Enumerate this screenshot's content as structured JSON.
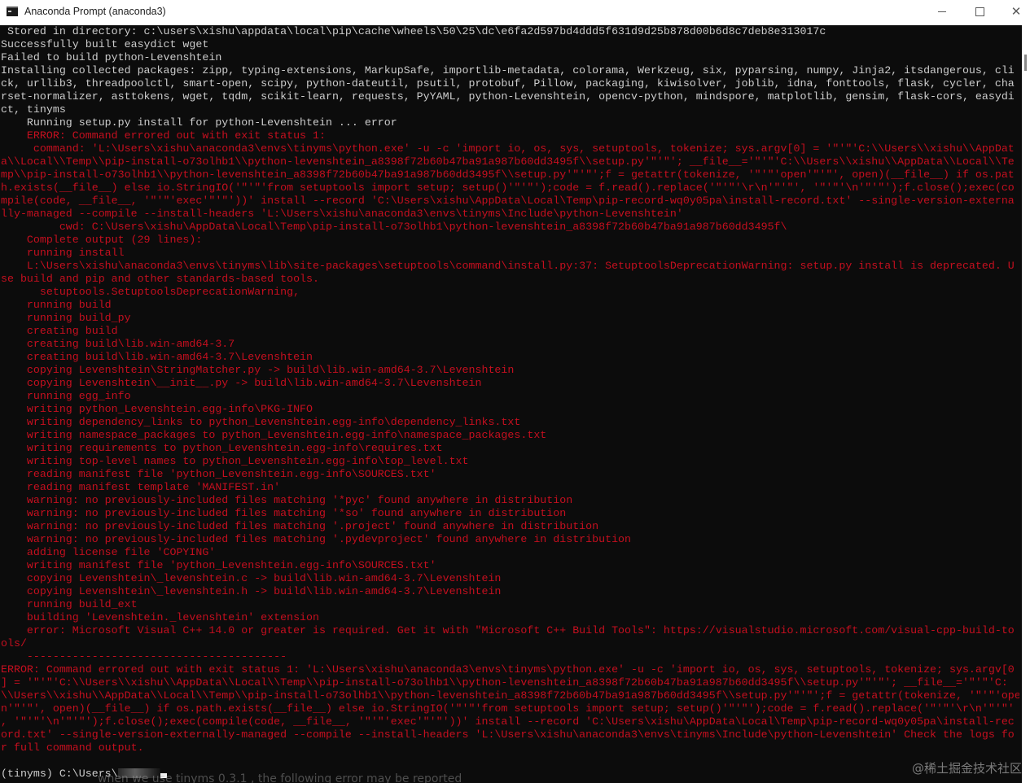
{
  "window": {
    "title": "Anaconda Prompt (anaconda3)"
  },
  "console": {
    "lines": [
      {
        "text": " Stored in directory: c:\\users\\xishu\\appdata\\local\\pip\\cache\\wheels\\50\\25\\dc\\e6fa2d597bd4ddd5f631d9d25b878d00b6d8c7deb8e313017c",
        "kind": "out"
      },
      {
        "text": "Successfully built easydict wget",
        "kind": "out"
      },
      {
        "text": "Failed to build python-Levenshtein",
        "kind": "out"
      },
      {
        "text": "Installing collected packages: zipp, typing-extensions, MarkupSafe, importlib-metadata, colorama, Werkzeug, six, pyparsing, numpy, Jinja2, itsdangerous, cli",
        "kind": "out"
      },
      {
        "text": "ck, urllib3, threadpoolctl, smart-open, scipy, python-dateutil, psutil, protobuf, Pillow, packaging, kiwisolver, joblib, idna, fonttools, flask, cycler, cha",
        "kind": "out"
      },
      {
        "text": "rset-normalizer, asttokens, wget, tqdm, scikit-learn, requests, PyYAML, python-Levenshtein, opencv-python, mindspore, matplotlib, gensim, flask-cors, easydi",
        "kind": "out"
      },
      {
        "text": "ct, tinyms",
        "kind": "out"
      },
      {
        "text": "    Running setup.py install for python-Levenshtein ... error",
        "kind": "out"
      },
      {
        "text": "    ERROR: Command errored out with exit status 1:",
        "kind": "err"
      },
      {
        "text": "     command: 'L:\\Users\\xishu\\anaconda3\\envs\\tinyms\\python.exe' -u -c 'import io, os, sys, setuptools, tokenize; sys.argv[0] = '\"'\"'C:\\\\Users\\\\xishu\\\\AppDat",
        "kind": "err"
      },
      {
        "text": "a\\\\Local\\\\Temp\\\\pip-install-o73olhb1\\\\python-levenshtein_a8398f72b60b47ba91a987b60dd3495f\\\\setup.py'\"'\"'; __file__='\"'\"'C:\\\\Users\\\\xishu\\\\AppData\\\\Local\\\\Te",
        "kind": "err"
      },
      {
        "text": "mp\\\\pip-install-o73olhb1\\\\python-levenshtein_a8398f72b60b47ba91a987b60dd3495f\\\\setup.py'\"'\"';f = getattr(tokenize, '\"'\"'open'\"'\"', open)(__file__) if os.pat",
        "kind": "err"
      },
      {
        "text": "h.exists(__file__) else io.StringIO('\"'\"'from setuptools import setup; setup()'\"'\"');code = f.read().replace('\"'\"'\\r\\n'\"'\"', '\"'\"'\\n'\"'\"');f.close();exec(co",
        "kind": "err"
      },
      {
        "text": "mpile(code, __file__, '\"'\"'exec'\"'\"'))' install --record 'C:\\Users\\xishu\\AppData\\Local\\Temp\\pip-record-wq0y05pa\\install-record.txt' --single-version-externa",
        "kind": "err"
      },
      {
        "text": "lly-managed --compile --install-headers 'L:\\Users\\xishu\\anaconda3\\envs\\tinyms\\Include\\python-Levenshtein'",
        "kind": "err"
      },
      {
        "text": "         cwd: C:\\Users\\xishu\\AppData\\Local\\Temp\\pip-install-o73olhb1\\python-levenshtein_a8398f72b60b47ba91a987b60dd3495f\\",
        "kind": "err"
      },
      {
        "text": "    Complete output (29 lines):",
        "kind": "err"
      },
      {
        "text": "    running install",
        "kind": "err"
      },
      {
        "text": "    L:\\Users\\xishu\\anaconda3\\envs\\tinyms\\lib\\site-packages\\setuptools\\command\\install.py:37: SetuptoolsDeprecationWarning: setup.py install is deprecated. U",
        "kind": "err"
      },
      {
        "text": "se build and pip and other standards-based tools.",
        "kind": "err"
      },
      {
        "text": "      setuptools.SetuptoolsDeprecationWarning,",
        "kind": "err"
      },
      {
        "text": "    running build",
        "kind": "err"
      },
      {
        "text": "    running build_py",
        "kind": "err"
      },
      {
        "text": "    creating build",
        "kind": "err"
      },
      {
        "text": "    creating build\\lib.win-amd64-3.7",
        "kind": "err"
      },
      {
        "text": "    creating build\\lib.win-amd64-3.7\\Levenshtein",
        "kind": "err"
      },
      {
        "text": "    copying Levenshtein\\StringMatcher.py -> build\\lib.win-amd64-3.7\\Levenshtein",
        "kind": "err"
      },
      {
        "text": "    copying Levenshtein\\__init__.py -> build\\lib.win-amd64-3.7\\Levenshtein",
        "kind": "err"
      },
      {
        "text": "    running egg_info",
        "kind": "err"
      },
      {
        "text": "    writing python_Levenshtein.egg-info\\PKG-INFO",
        "kind": "err"
      },
      {
        "text": "    writing dependency_links to python_Levenshtein.egg-info\\dependency_links.txt",
        "kind": "err"
      },
      {
        "text": "    writing namespace_packages to python_Levenshtein.egg-info\\namespace_packages.txt",
        "kind": "err"
      },
      {
        "text": "    writing requirements to python_Levenshtein.egg-info\\requires.txt",
        "kind": "err"
      },
      {
        "text": "    writing top-level names to python_Levenshtein.egg-info\\top_level.txt",
        "kind": "err"
      },
      {
        "text": "    reading manifest file 'python_Levenshtein.egg-info\\SOURCES.txt'",
        "kind": "err"
      },
      {
        "text": "    reading manifest template 'MANIFEST.in'",
        "kind": "err"
      },
      {
        "text": "    warning: no previously-included files matching '*pyc' found anywhere in distribution",
        "kind": "err"
      },
      {
        "text": "    warning: no previously-included files matching '*so' found anywhere in distribution",
        "kind": "err"
      },
      {
        "text": "    warning: no previously-included files matching '.project' found anywhere in distribution",
        "kind": "err"
      },
      {
        "text": "    warning: no previously-included files matching '.pydevproject' found anywhere in distribution",
        "kind": "err"
      },
      {
        "text": "    adding license file 'COPYING'",
        "kind": "err"
      },
      {
        "text": "    writing manifest file 'python_Levenshtein.egg-info\\SOURCES.txt'",
        "kind": "err"
      },
      {
        "text": "    copying Levenshtein\\_levenshtein.c -> build\\lib.win-amd64-3.7\\Levenshtein",
        "kind": "err"
      },
      {
        "text": "    copying Levenshtein\\_levenshtein.h -> build\\lib.win-amd64-3.7\\Levenshtein",
        "kind": "err"
      },
      {
        "text": "    running build_ext",
        "kind": "err"
      },
      {
        "text": "    building 'Levenshtein._levenshtein' extension",
        "kind": "err"
      },
      {
        "text": "    error: Microsoft Visual C++ 14.0 or greater is required. Get it with \"Microsoft C++ Build Tools\": https://visualstudio.microsoft.com/visual-cpp-build-to",
        "kind": "err"
      },
      {
        "text": "ols/",
        "kind": "err"
      },
      {
        "text": "    ----------------------------------------",
        "kind": "err"
      },
      {
        "text": "ERROR: Command errored out with exit status 1: 'L:\\Users\\xishu\\anaconda3\\envs\\tinyms\\python.exe' -u -c 'import io, os, sys, setuptools, tokenize; sys.argv[0",
        "kind": "err"
      },
      {
        "text": "] = '\"'\"'C:\\\\Users\\\\xishu\\\\AppData\\\\Local\\\\Temp\\\\pip-install-o73olhb1\\\\python-levenshtein_a8398f72b60b47ba91a987b60dd3495f\\\\setup.py'\"'\"'; __file__='\"'\"'C:",
        "kind": "err"
      },
      {
        "text": "\\\\Users\\\\xishu\\\\AppData\\\\Local\\\\Temp\\\\pip-install-o73olhb1\\\\python-levenshtein_a8398f72b60b47ba91a987b60dd3495f\\\\setup.py'\"'\"';f = getattr(tokenize, '\"'\"'ope",
        "kind": "err"
      },
      {
        "text": "n'\"'\"', open)(__file__) if os.path.exists(__file__) else io.StringIO('\"'\"'from setuptools import setup; setup()'\"'\"');code = f.read().replace('\"'\"'\\r\\n'\"'\"'",
        "kind": "err"
      },
      {
        "text": ", '\"'\"'\\n'\"'\"');f.close();exec(compile(code, __file__, '\"'\"'exec'\"'\"'))' install --record 'C:\\Users\\xishu\\AppData\\Local\\Temp\\pip-record-wq0y05pa\\install-rec",
        "kind": "err"
      },
      {
        "text": "ord.txt' --single-version-externally-managed --compile --install-headers 'L:\\Users\\xishu\\anaconda3\\envs\\tinyms\\Include\\python-Levenshtein' Check the logs fo",
        "kind": "err"
      },
      {
        "text": "r full command output.",
        "kind": "err"
      },
      {
        "text": "",
        "kind": "gap"
      }
    ],
    "prompt": "(tinyms) C:\\Users\\"
  },
  "overlay": {
    "ghost_text": "when we use  tinyms 0.3.1 , the following error may be reported",
    "watermark": "@稀土掘金技术社区"
  }
}
